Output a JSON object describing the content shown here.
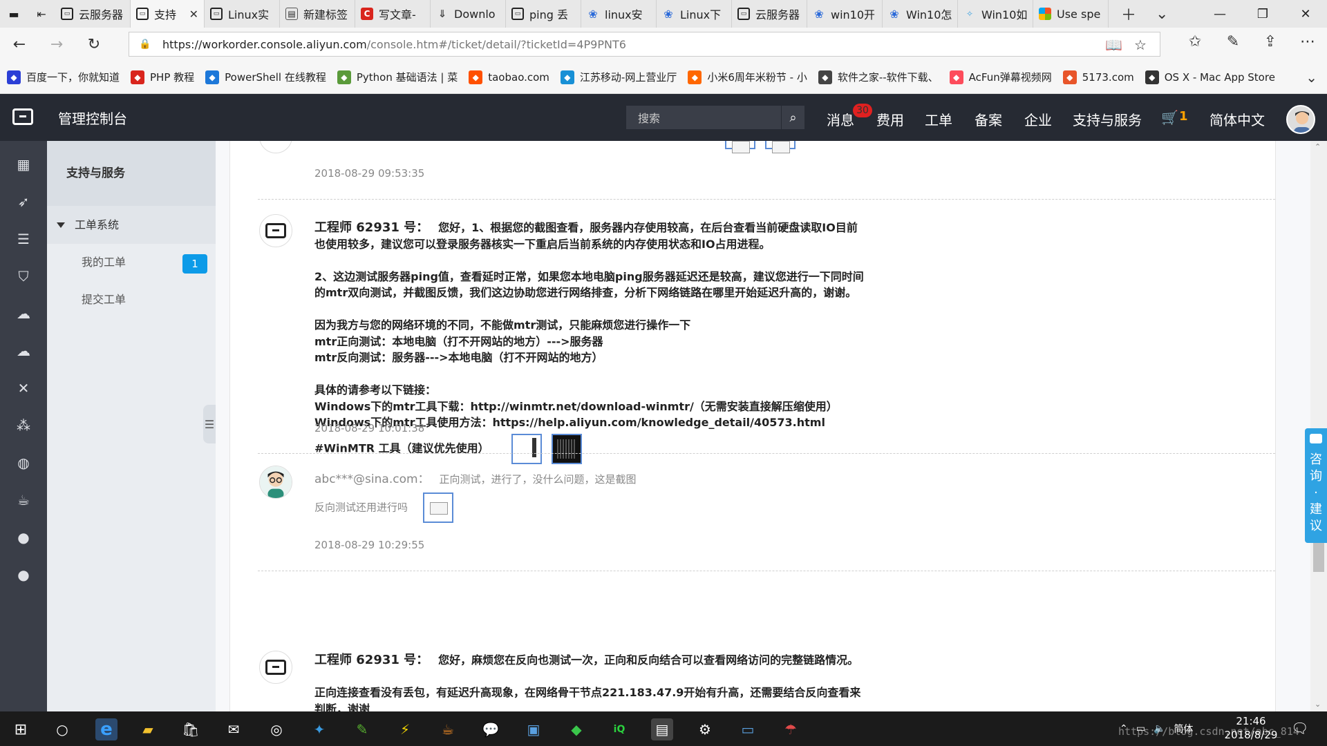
{
  "browser": {
    "tabs": [
      {
        "label": "云服务器",
        "icon": "aliyun"
      },
      {
        "label": "支持",
        "icon": "aliyun",
        "active": true
      },
      {
        "label": "Linux实",
        "icon": "aliyun"
      },
      {
        "label": "新建标签",
        "icon": "doc"
      },
      {
        "label": "写文章-",
        "icon": "red"
      },
      {
        "label": "Downlo",
        "icon": "dl"
      },
      {
        "label": "ping 丢",
        "icon": "aliyun"
      },
      {
        "label": "linux安",
        "icon": "paw"
      },
      {
        "label": "Linux下",
        "icon": "paw"
      },
      {
        "label": "云服务器",
        "icon": "aliyun"
      },
      {
        "label": "win10开",
        "icon": "paw"
      },
      {
        "label": "Win10怎",
        "icon": "paw"
      },
      {
        "label": "Win10如",
        "icon": "bird"
      },
      {
        "label": "Use spe",
        "icon": "ms"
      }
    ],
    "url_host": "https://workorder.console.aliyun.com",
    "url_path": "/console.htm#/ticket/detail/?ticketId=4P9PNT6",
    "favorites": [
      {
        "label": "百度一下，你就知道",
        "icon_color": "#2b3fd6"
      },
      {
        "label": "PHP 教程",
        "icon_color": "#d9251d"
      },
      {
        "label": "PowerShell 在线教程",
        "icon_color": "#1d78d9"
      },
      {
        "label": "Python 基础语法 | 菜",
        "icon_color": "#5a9a3a"
      },
      {
        "label": "taobao.com",
        "icon_color": "#ff5000"
      },
      {
        "label": "江苏移动-网上营业厅",
        "icon_color": "#1890d6"
      },
      {
        "label": "小米6周年米粉节 - 小",
        "icon_color": "#ff6700"
      },
      {
        "label": "软件之家--软件下载、",
        "icon_color": "#444444"
      },
      {
        "label": "AcFun弹幕视频网",
        "icon_color": "#fd4c5b"
      },
      {
        "label": "5173.com",
        "icon_color": "#e8552a"
      },
      {
        "label": "OS X - Mac App Store",
        "icon_color": "#333333"
      }
    ]
  },
  "console": {
    "title": "管理控制台",
    "search_placeholder": "搜索",
    "nav": [
      "消息",
      "费用",
      "工单",
      "备案",
      "企业",
      "支持与服务"
    ],
    "msg_count": "30",
    "cart_count": "1",
    "language": "简体中文"
  },
  "sidebar": {
    "title": "支持与服务",
    "group": "工单系统",
    "items": [
      {
        "label": "我的工单",
        "badge": "1"
      },
      {
        "label": "提交工单"
      }
    ]
  },
  "ticket": {
    "prev_time": "2018-08-29 09:53:35",
    "messages": [
      {
        "author": "工程师 62931 号：",
        "lines": [
          "您好，1、根据您的截图查看，服务器内存使用较高，在后台查看当前硬盘读取IO目前",
          "也使用较多，建议您可以登录服务器核实一下重启后当前系统的内存使用状态和IO占用进程。",
          "",
          "2、这边测试服务器ping值，查看延时正常，如果您本地电脑ping服务器延迟还是较高，建议您进行一下同时间",
          "的mtr双向测试，并截图反馈，我们这边协助您进行网络排查，分析下网络链路在哪里开始延迟升高的，谢谢。",
          "",
          "因为我方与您的网络环境的不同，不能做mtr测试，只能麻烦您进行操作一下",
          "mtr正向测试：本地电脑（打不开网站的地方）--->服务器",
          "mtr反向测试：服务器--->本地电脑（打不开网站的地方）",
          "",
          "具体的请参考以下链接：",
          "Windows下的mtr工具下载：http://winmtr.net/download-winmtr/（无需安装直接解压缩使用）",
          "Windows下的mtr工具使用方法：https://help.aliyun.com/knowledge_detail/40573.html"
        ],
        "last_line": "#WinMTR 工具（建议优先使用）",
        "time": "2018-08-29 10:01:38"
      },
      {
        "author": "abc***@sina.com：",
        "lines": [
          "正向测试，进行了，没什么问题，这是截图"
        ],
        "last_line": "反向测试还用进行吗",
        "time": "2018-08-29 10:29:55"
      },
      {
        "author": "工程师 62931 号：",
        "lines": [
          "您好，麻烦您在反向也测试一次，正向和反向结合可以查看网络访问的完整链路情况。",
          "",
          "正向连接查看没有丢包，有延迟升高现象，在网络骨干节点221.183.47.9开始有升高，还需要结合反向查看来",
          "判断，谢谢"
        ]
      }
    ]
  },
  "consult_label": [
    "咨",
    "询",
    "·",
    "建",
    "议"
  ],
  "taskbar": {
    "ime": "简体",
    "time": "21:46",
    "date": "2018/8/29",
    "watermark": "https://blog.csdn.net/abc_814"
  }
}
